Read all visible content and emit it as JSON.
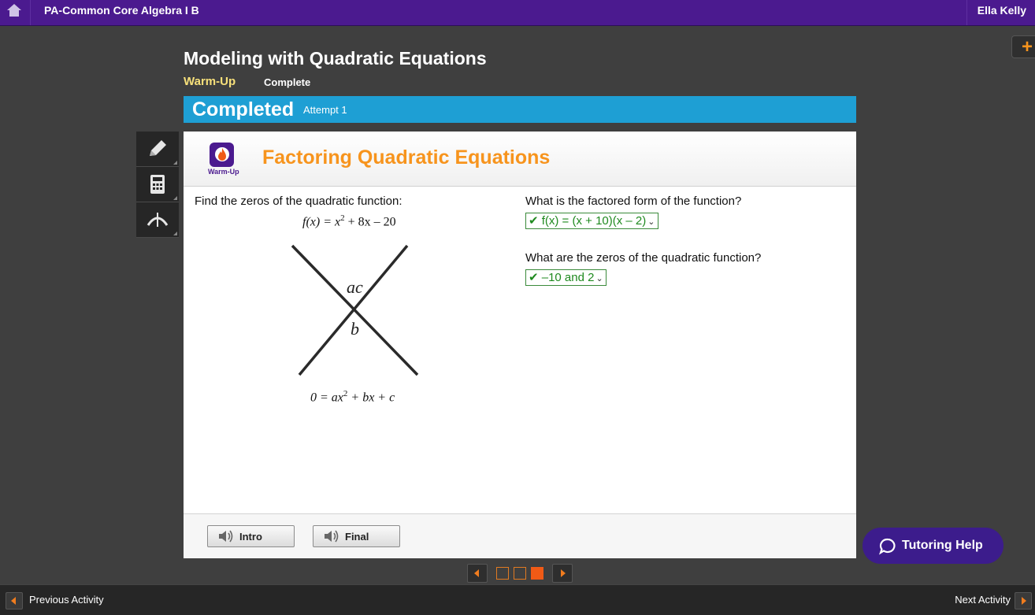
{
  "topbar": {
    "course_title": "PA-Common Core Algebra I B",
    "user_name": "Ella Kelly"
  },
  "header": {
    "page_title": "Modeling with Quadratic Equations",
    "activity_label": "Warm-Up",
    "status_label": "Complete",
    "plus_icon": "+"
  },
  "banner": {
    "status": "Completed",
    "attempt": "Attempt 1"
  },
  "tools": [
    "pencil-icon",
    "calculator-icon",
    "graph-icon"
  ],
  "panel": {
    "icon_caption": "Warm-Up",
    "section_title": "Factoring Quadratic Equations",
    "question1": {
      "prompt": "Find the zeros of the quadratic function:",
      "function_lhs": "f(x) = x",
      "function_exp": "2",
      "function_rhs": " + 8x – 20",
      "diagram_top": "ac",
      "diagram_mid": "b",
      "equation_lhs": "0 = ax",
      "equation_exp": "2",
      "equation_rhs": " + bx + c"
    },
    "question2": {
      "prompt": "What is the factored form of the function?",
      "answer": "✔ f(x) = (x + 10)(x – 2)"
    },
    "question3": {
      "prompt": "What are the zeros of the quadratic function?",
      "answer": "✔ –10 and 2"
    },
    "footer": {
      "intro_label": "Intro",
      "final_label": "Final"
    }
  },
  "tutoring": {
    "label": "Tutoring Help"
  },
  "pager": {
    "pages": 3,
    "current": 3
  },
  "bottom": {
    "prev_label": "Previous Activity",
    "next_label": "Next Activity"
  },
  "colors": {
    "accent": "#f7941d",
    "brand": "#4b1a8f",
    "banner": "#1e9fd4",
    "correct": "#1f8a1f"
  }
}
